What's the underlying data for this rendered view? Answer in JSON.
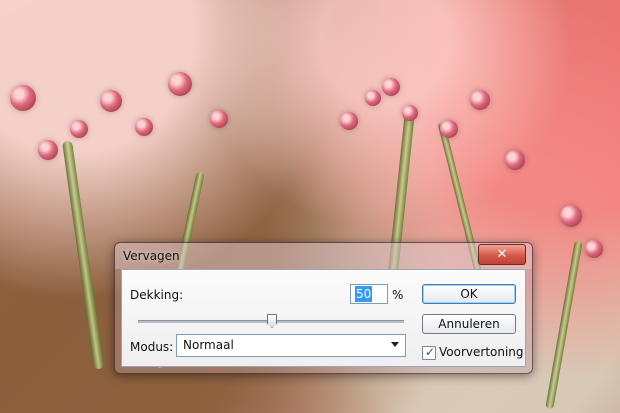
{
  "dialog": {
    "title": "Vervagen",
    "close_label": "✕",
    "opacity": {
      "label": "Dekking:",
      "value": "50",
      "unit": "%"
    },
    "slider": {
      "value_percent": 50
    },
    "mode": {
      "label": "Modus:",
      "selected": "Normaal"
    },
    "buttons": {
      "ok": "OK",
      "cancel": "Annuleren"
    },
    "preview": {
      "label": "Voorvertoning",
      "checked": true,
      "checkmark": "✓"
    }
  }
}
